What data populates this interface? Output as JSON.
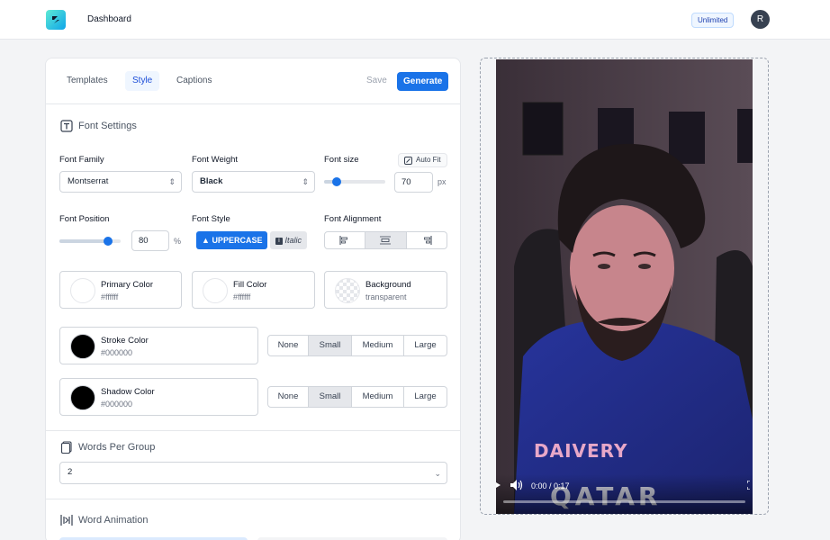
{
  "header": {
    "app_title": "Dashboard",
    "plan": "Unlimited",
    "avatar_initial": "R"
  },
  "tabs": [
    {
      "label": "Templates"
    },
    {
      "label": "Style"
    },
    {
      "label": "Captions"
    }
  ],
  "actions": {
    "save": "Save",
    "generate": "Generate"
  },
  "font_settings": {
    "title": "Font Settings",
    "family_label": "Font Family",
    "family_value": "Montserrat",
    "weight_label": "Font Weight",
    "weight_value": "Black",
    "size_label": "Font size",
    "auto_fit": "Auto Fit",
    "size_value": "70",
    "size_unit": "px",
    "size_slider_fraction": 0.2,
    "position_label": "Font Position",
    "position_value": "80",
    "position_unit": "%",
    "position_slider_fraction": 0.8,
    "style_label": "Font Style",
    "uppercase": "UPPERCASE",
    "italic": "Italic",
    "alignment_label": "Font Alignment",
    "alignment_selected": "center"
  },
  "colors": {
    "primary": {
      "name": "Primary Color",
      "value": "#ffffff"
    },
    "fill": {
      "name": "Fill Color",
      "value": "#ffffff"
    },
    "background": {
      "name": "Background",
      "value": "transparent"
    },
    "stroke": {
      "name": "Stroke Color",
      "value": "#000000"
    },
    "shadow": {
      "name": "Shadow Color",
      "value": "#000000"
    }
  },
  "size_options": [
    "None",
    "Small",
    "Medium",
    "Large"
  ],
  "stroke_size_selected": "Small",
  "shadow_size_selected": "Small",
  "words_per_group": {
    "title": "Words Per Group",
    "value": "2"
  },
  "word_animation": {
    "title": "Word Animation"
  },
  "video": {
    "time": "0:00 / 0:17"
  },
  "accent_color": "#1a73e8"
}
